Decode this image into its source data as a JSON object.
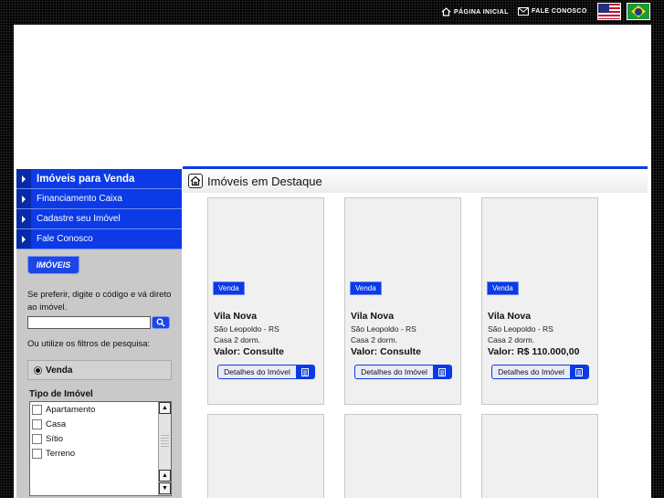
{
  "topbar": {
    "home_label": "PÁGINA INICIAL",
    "contact_label": "FALE CONOSCO",
    "flags": [
      "us-flag",
      "brazil-flag"
    ]
  },
  "sidebar": {
    "menu": [
      {
        "label": "Imóveis para Venda"
      },
      {
        "label": "Financiamento Caixa"
      },
      {
        "label": "Cadastre seu Imóvel"
      },
      {
        "label": "Fale Conosco"
      }
    ],
    "tab_label": "IMÓVEIS",
    "code_prompt": "Se preferir, digite o código e vá direto ao imóvel.",
    "code_placeholder": "",
    "filter_prompt": "Ou utilize os filtros de pesquisa:",
    "radio_label": "Venda",
    "tipo_label": "Tipo de Imóvel",
    "tipo_options": [
      "Apartamento",
      "Casa",
      "Sítio",
      "Terreno"
    ]
  },
  "featured": {
    "title": "Imóveis em Destaque",
    "cards": [
      {
        "badge": "Venda",
        "name": "Vila Nova",
        "location": "São Leopoldo - RS",
        "type": "Casa 2 dorm.",
        "price": "Valor: Consulte",
        "button": "Detalhes do Imóvel"
      },
      {
        "badge": "Venda",
        "name": "Vila Nova",
        "location": "São Leopoldo - RS",
        "type": "Casa 2 dorm.",
        "price": "Valor: Consulte",
        "button": "Detalhes do Imóvel"
      },
      {
        "badge": "Venda",
        "name": "Vila Nova",
        "location": "São Leopoldo - RS",
        "type": "Casa 2 dorm.",
        "price": "Valor: R$ 110.000,00",
        "button": "Detalhes do Imóvel"
      }
    ]
  },
  "colors": {
    "accent": "#0b3ae6",
    "sidebar_bg": "#c9c9c9",
    "page_bg": "#000000"
  }
}
